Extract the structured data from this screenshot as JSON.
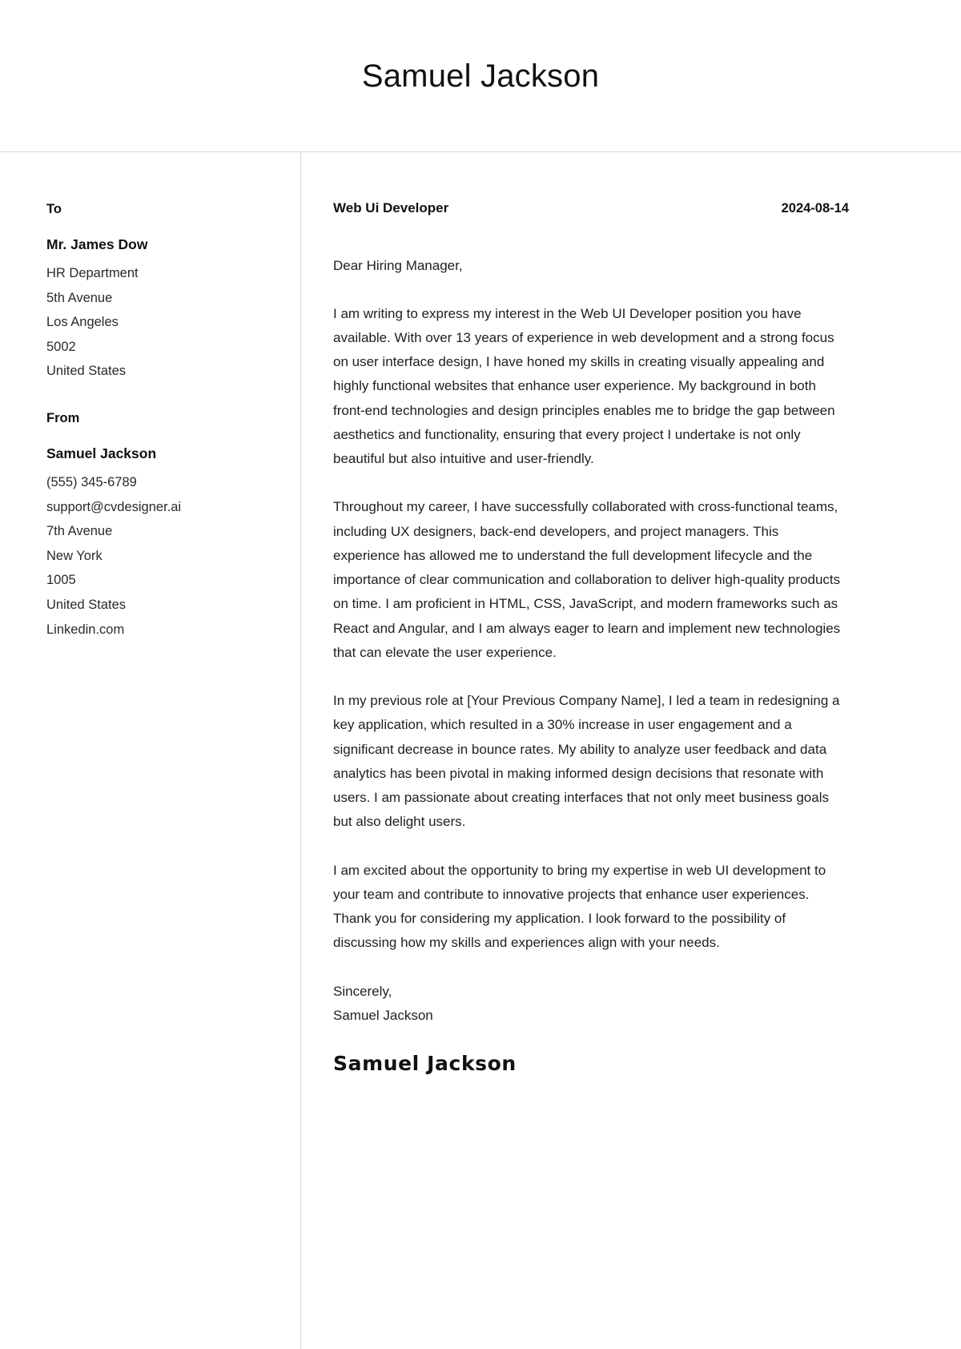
{
  "header": {
    "candidate_name": "Samuel Jackson"
  },
  "sidebar": {
    "to": {
      "label": "To",
      "name": "Mr. James Dow",
      "lines": [
        "HR Department",
        "5th Avenue",
        "Los Angeles",
        "5002",
        "United States"
      ]
    },
    "from": {
      "label": "From",
      "name": "Samuel Jackson",
      "lines": [
        "(555) 345-6789",
        "support@cvdesigner.ai",
        "7th Avenue",
        "New York",
        "1005",
        "United States",
        "Linkedin.com"
      ]
    }
  },
  "letter": {
    "job_title": "Web Ui Developer",
    "date": "2024-08-14",
    "salutation": "Dear Hiring Manager,",
    "paragraphs": [
      "I am writing to express my interest in the Web UI Developer position you have available. With over 13 years of experience in web development and a strong focus on user interface design, I have honed my skills in creating visually appealing and highly functional websites that enhance user experience. My background in both front-end technologies and design principles enables me to bridge the gap between aesthetics and functionality, ensuring that every project I undertake is not only beautiful but also intuitive and user-friendly.",
      "Throughout my career, I have successfully collaborated with cross-functional teams, including UX designers, back-end developers, and project managers. This experience has allowed me to understand the full development lifecycle and the importance of clear communication and collaboration to deliver high-quality products on time. I am proficient in HTML, CSS, JavaScript, and modern frameworks such as React and Angular, and I am always eager to learn and implement new technologies that can elevate the user experience.",
      "In my previous role at [Your Previous Company Name], I led a team in redesigning a key application, which resulted in a 30% increase in user engagement and a significant decrease in bounce rates. My ability to analyze user feedback and data analytics has been pivotal in making informed design decisions that resonate with users. I am passionate about creating interfaces that not only meet business goals but also delight users.",
      "I am excited about the opportunity to bring my expertise in web UI development to your team and contribute to innovative projects that enhance user experiences. Thank you for considering my application. I look forward to the possibility of discussing how my skills and experiences align with your needs."
    ],
    "closing_word": "Sincerely,",
    "closing_name": "Samuel Jackson",
    "signature": "Samuel Jackson"
  }
}
